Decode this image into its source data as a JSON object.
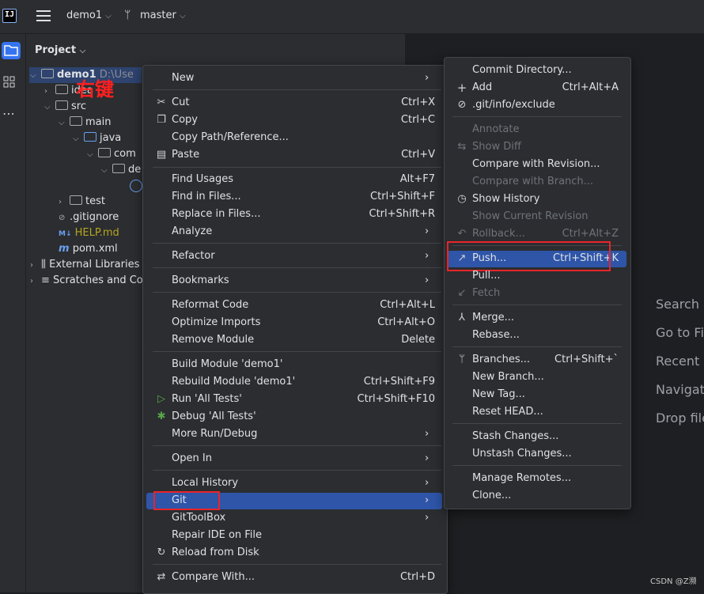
{
  "topbar": {
    "project": "demo1",
    "branch": "master"
  },
  "project_panel": {
    "title": "Project",
    "annotation": "右键",
    "tree": [
      {
        "label": "demo1",
        "suffix": "D:\\Use"
      },
      {
        "label": "idea"
      },
      {
        "label": "src"
      },
      {
        "label": "main"
      },
      {
        "label": "java"
      },
      {
        "label": "com"
      },
      {
        "label": "de"
      },
      {
        "label": "test"
      },
      {
        "label": ".gitignore"
      },
      {
        "label": "HELP.md"
      },
      {
        "label": "pom.xml"
      },
      {
        "label": "External Libraries"
      },
      {
        "label": "Scratches and Co"
      }
    ]
  },
  "editor_hints": [
    "Search E",
    "Go to Fi",
    "Recent F",
    "Navigati",
    "Drop file"
  ],
  "watermark": "CSDN @Z濒",
  "context_menu": {
    "items": [
      {
        "label": "New",
        "shortcut": ""
      },
      {
        "label": "Cut",
        "shortcut": "Ctrl+X"
      },
      {
        "label": "Copy",
        "shortcut": "Ctrl+C"
      },
      {
        "label": "Copy Path/Reference...",
        "shortcut": ""
      },
      {
        "label": "Paste",
        "shortcut": "Ctrl+V"
      },
      {
        "label": "Find Usages",
        "shortcut": "Alt+F7"
      },
      {
        "label": "Find in Files...",
        "shortcut": "Ctrl+Shift+F"
      },
      {
        "label": "Replace in Files...",
        "shortcut": "Ctrl+Shift+R"
      },
      {
        "label": "Analyze",
        "shortcut": ""
      },
      {
        "label": "Refactor",
        "shortcut": ""
      },
      {
        "label": "Bookmarks",
        "shortcut": ""
      },
      {
        "label": "Reformat Code",
        "shortcut": "Ctrl+Alt+L"
      },
      {
        "label": "Optimize Imports",
        "shortcut": "Ctrl+Alt+O"
      },
      {
        "label": "Remove Module",
        "shortcut": "Delete"
      },
      {
        "label": "Build Module 'demo1'",
        "shortcut": ""
      },
      {
        "label": "Rebuild Module 'demo1'",
        "shortcut": "Ctrl+Shift+F9"
      },
      {
        "label": "Run 'All Tests'",
        "shortcut": "Ctrl+Shift+F10"
      },
      {
        "label": "Debug 'All Tests'",
        "shortcut": ""
      },
      {
        "label": "More Run/Debug",
        "shortcut": ""
      },
      {
        "label": "Open In",
        "shortcut": ""
      },
      {
        "label": "Local History",
        "shortcut": ""
      },
      {
        "label": "Git",
        "shortcut": ""
      },
      {
        "label": "GitToolBox",
        "shortcut": ""
      },
      {
        "label": "Repair IDE on File",
        "shortcut": ""
      },
      {
        "label": "Reload from Disk",
        "shortcut": ""
      },
      {
        "label": "Compare With...",
        "shortcut": "Ctrl+D"
      }
    ]
  },
  "git_submenu": {
    "items": [
      {
        "label": "Commit Directory...",
        "shortcut": ""
      },
      {
        "label": "Add",
        "shortcut": "Ctrl+Alt+A"
      },
      {
        "label": ".git/info/exclude",
        "shortcut": ""
      },
      {
        "label": "Annotate",
        "shortcut": ""
      },
      {
        "label": "Show Diff",
        "shortcut": ""
      },
      {
        "label": "Compare with Revision...",
        "shortcut": ""
      },
      {
        "label": "Compare with Branch...",
        "shortcut": ""
      },
      {
        "label": "Show History",
        "shortcut": ""
      },
      {
        "label": "Show Current Revision",
        "shortcut": ""
      },
      {
        "label": "Rollback...",
        "shortcut": "Ctrl+Alt+Z"
      },
      {
        "label": "Push...",
        "shortcut": "Ctrl+Shift+K"
      },
      {
        "label": "Pull...",
        "shortcut": ""
      },
      {
        "label": "Fetch",
        "shortcut": ""
      },
      {
        "label": "Merge...",
        "shortcut": ""
      },
      {
        "label": "Rebase...",
        "shortcut": ""
      },
      {
        "label": "Branches...",
        "shortcut": "Ctrl+Shift+`"
      },
      {
        "label": "New Branch...",
        "shortcut": ""
      },
      {
        "label": "New Tag...",
        "shortcut": ""
      },
      {
        "label": "Reset HEAD...",
        "shortcut": ""
      },
      {
        "label": "Stash Changes...",
        "shortcut": ""
      },
      {
        "label": "Unstash Changes...",
        "shortcut": ""
      },
      {
        "label": "Manage Remotes...",
        "shortcut": ""
      },
      {
        "label": "Clone...",
        "shortcut": ""
      }
    ]
  },
  "colors": {
    "highlight": "#2e55a8",
    "annotation_red": "#e8242a",
    "accent": "#3574f0"
  }
}
